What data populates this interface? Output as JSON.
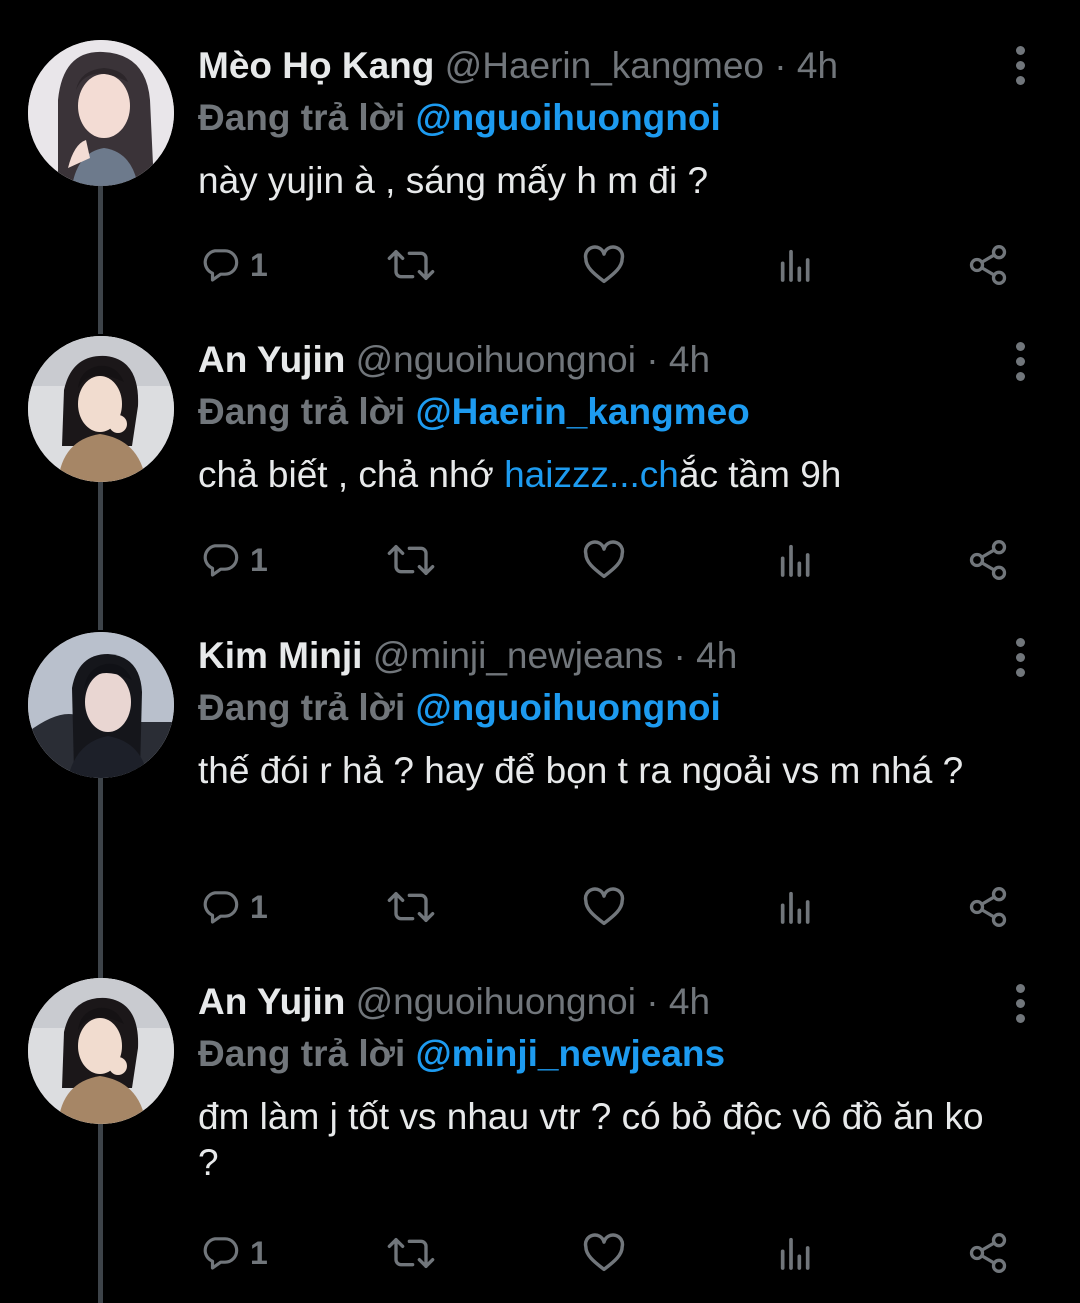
{
  "tweets": [
    {
      "name": "Mèo Họ Kang",
      "handle": "@Haerin_kangmeo",
      "separator": "·",
      "time": "4h",
      "reply_prefix": "Đang trả lời",
      "reply_to": "@nguoihuongnoi",
      "text_before": "này yujin à , sáng mấy h m đi ?",
      "text_link": "",
      "text_after": "",
      "reply_count": "1",
      "avatar_icon": "avatar-long-hair-girl"
    },
    {
      "name": "An Yujin",
      "handle": "@nguoihuongnoi",
      "separator": "·",
      "time": "4h",
      "reply_prefix": "Đang trả lời",
      "reply_to": "@Haerin_kangmeo",
      "text_before": "chả biết , chả nhớ ",
      "text_link": "haizzz...ch",
      "text_after": "ắc tầm 9h",
      "reply_count": "1",
      "avatar_icon": "avatar-girl-beige-coat"
    },
    {
      "name": "Kim Minji",
      "handle": "@minji_newjeans",
      "separator": "·",
      "time": "4h",
      "reply_prefix": "Đang trả lời",
      "reply_to": "@nguoihuongnoi",
      "text_before": "thế đói r hả ? hay để bọn t ra ngoải vs m nhá ?",
      "text_link": "",
      "text_after": "",
      "reply_count": "1",
      "avatar_icon": "avatar-dark-hair-girl"
    },
    {
      "name": "An Yujin",
      "handle": "@nguoihuongnoi",
      "separator": "·",
      "time": "4h",
      "reply_prefix": "Đang trả lời",
      "reply_to": "@minji_newjeans",
      "text_before": "đm làm j tốt vs nhau vtr ? có bỏ độc vô đồ ăn ko ?",
      "text_link": "",
      "text_after": "",
      "reply_count": "1",
      "avatar_icon": "avatar-girl-beige-coat"
    }
  ],
  "icons": {
    "reply": "reply-icon",
    "retweet": "retweet-icon",
    "like": "heart-icon",
    "views": "views-icon",
    "share": "share-icon",
    "more": "more-vertical-icon"
  },
  "colors": {
    "background": "#000000",
    "text": "#e7e9ea",
    "muted": "#71767b",
    "accent": "#1d9bf0",
    "thread_line": "#3d4349"
  }
}
